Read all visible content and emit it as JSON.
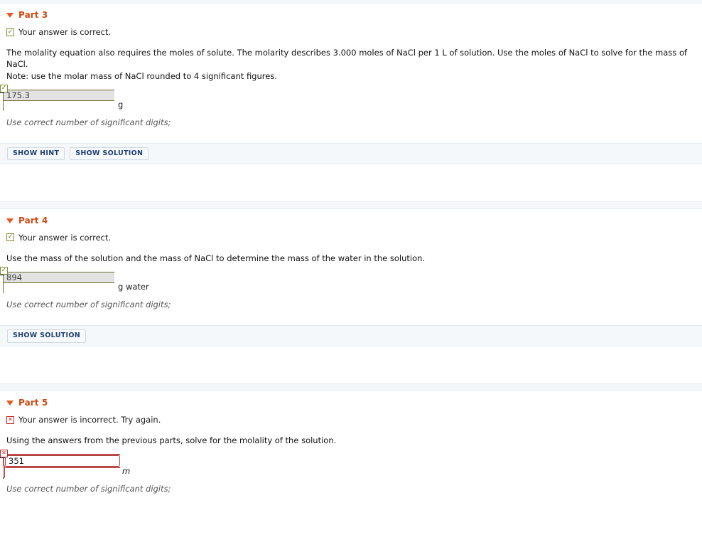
{
  "parts": [
    {
      "id": "part-3",
      "title": "Part 3",
      "status_icon": "check-icon",
      "status_glyph": "✓",
      "status_text": "Your answer is correct.",
      "status_kind": "ok",
      "prompt_line1": "The molality equation also requires the moles of solute. The molarity describes 3.000 moles of NaCl per 1 L of solution. Use the moles of NaCl to solve for the mass of NaCl.",
      "prompt_line2": "Note: use the molar mass of NaCl rounded to 4 significant figures.",
      "answer_value": "175.3",
      "answer_placeholder": "",
      "unit": "g",
      "unit_italic": false,
      "sig_note": "Use correct number of significant digits;",
      "buttons": [
        "SHOW HINT",
        "SHOW SOLUTION"
      ]
    },
    {
      "id": "part-4",
      "title": "Part 4",
      "status_icon": "check-icon",
      "status_glyph": "✓",
      "status_text": "Your answer is correct.",
      "status_kind": "ok",
      "prompt_line1": "Use the mass of the solution and the mass of NaCl to determine the mass of the water in the solution.",
      "prompt_line2": "",
      "answer_value": "894",
      "answer_placeholder": "",
      "unit": "g water",
      "unit_italic": false,
      "sig_note": "Use correct number of significant digits;",
      "buttons": [
        "SHOW SOLUTION"
      ]
    },
    {
      "id": "part-5",
      "title": "Part 5",
      "status_icon": "cross-icon",
      "status_glyph": "✕",
      "status_text": "Your answer is incorrect.  Try again.",
      "status_kind": "bad",
      "prompt_line1": "Using the answers from the previous parts, solve for the molality of the solution.",
      "prompt_line2": "",
      "answer_value": "351",
      "answer_placeholder": "",
      "unit": "m",
      "unit_italic": true,
      "sig_note": "Use correct number of significant digits;",
      "buttons": []
    }
  ],
  "colors": {
    "part_title": "#cc4a12",
    "triangle": "#e8561b",
    "correct_border": "#6b6b2b",
    "correct_fill": "#e2e2e2",
    "incorrect_border": "#c0504d",
    "button_text": "#1f3d73",
    "bar_background": "#f4f8fb",
    "badge": "#2c5aa0"
  }
}
